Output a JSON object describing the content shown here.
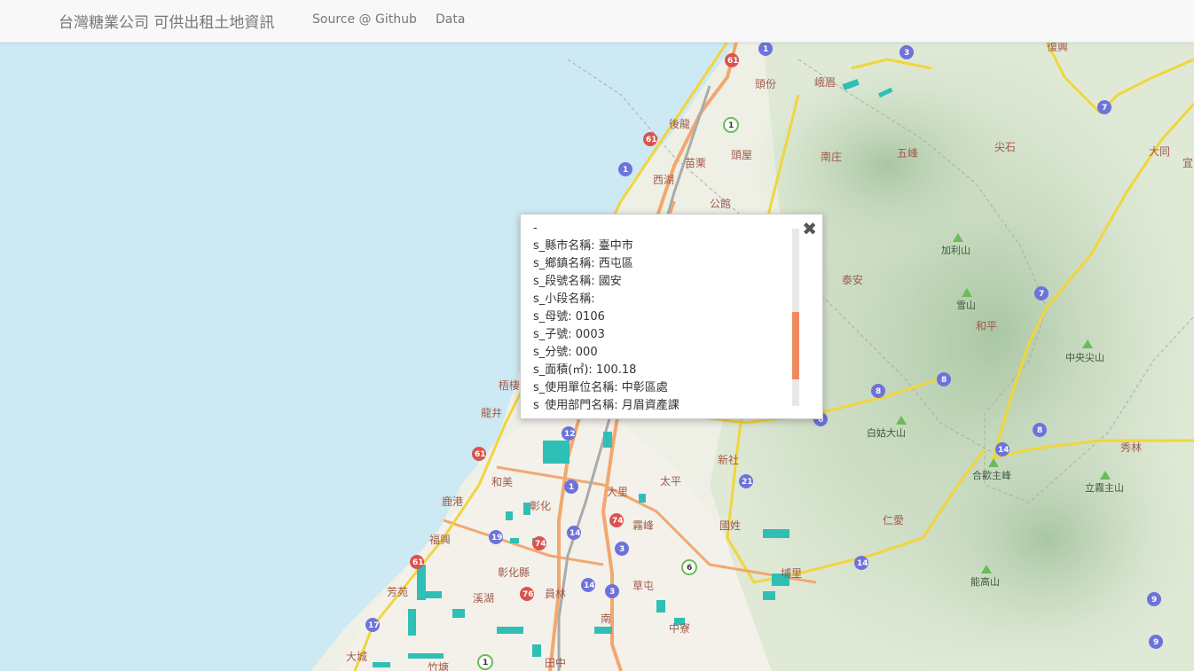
{
  "navbar": {
    "brand": "台灣糖業公司 可供出租土地資訊",
    "links": [
      {
        "label": "Source @ Github"
      },
      {
        "label": "Data"
      }
    ]
  },
  "map": {
    "places": [
      "頭份",
      "峨眉",
      "後龍",
      "苗栗",
      "頭屋",
      "西湖",
      "公館",
      "南庄",
      "五峰",
      "尖石",
      "大同",
      "泰安",
      "和平",
      "新社",
      "太平",
      "國姓",
      "仁愛",
      "大里",
      "霧峰",
      "彰化",
      "和美",
      "鹿港",
      "福興",
      "彰化縣",
      "芳苑",
      "溪湖",
      "員林",
      "草屯",
      "中寮",
      "埔里",
      "大城",
      "竹塘",
      "田中",
      "南",
      "秀林",
      "龍井",
      "梧棲",
      "宜",
      "復興"
    ],
    "peaks": [
      "加利山",
      "雪山",
      "中央尖山",
      "白姑大山",
      "合歡主峰",
      "立霧主山",
      "能高山"
    ],
    "shields": [
      "1",
      "3",
      "7",
      "61",
      "1",
      "1",
      "61",
      "7",
      "8",
      "8",
      "14",
      "8",
      "12",
      "61",
      "1",
      "74",
      "19",
      "14",
      "3",
      "6",
      "14",
      "74",
      "17",
      "9",
      "9",
      "61",
      "76",
      "14",
      "3",
      "1",
      "21",
      "6"
    ]
  },
  "popup": {
    "close_icon": "✖",
    "lines": [
      "-",
      "s_縣市名稱: 臺中市",
      "s_鄉鎮名稱: 西屯區",
      "s_段號名稱: 國安",
      "s_小段名稱:",
      "s_母號: 0106",
      "s_子號: 0003",
      "s_分號: 000",
      "s_面積(㎡): 100.18",
      "s_使用單位名稱: 中彰區處",
      "s_使用部門名稱: 月眉資產課"
    ],
    "scroll_position": 0.47
  }
}
